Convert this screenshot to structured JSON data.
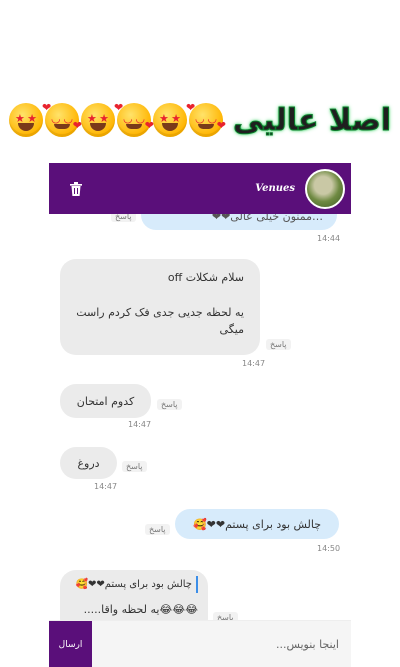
{
  "caption": {
    "text": "اصلا عالیی",
    "emoji_count": 6
  },
  "header": {
    "name": "Venues",
    "delete_icon": "trash-icon",
    "background": "#5a0f7a"
  },
  "messages": [
    {
      "dir": "out",
      "text": "…ممنون خیلی عالی❤❤",
      "reply": "پاسخ",
      "time": "14:44"
    },
    {
      "dir": "in",
      "text": "سلام شکلات off",
      "text2": "یه لحظه جدیی جدی فک کردم راست میگی",
      "reply": "پاسخ",
      "time": "14:47"
    },
    {
      "dir": "in",
      "text": "کدوم امتحان",
      "reply": "پاسخ",
      "time": "14:47"
    },
    {
      "dir": "in",
      "text": "دروغ",
      "reply": "پاسخ",
      "time": "14:47"
    },
    {
      "dir": "out",
      "text": "چالش بود برای پستم❤❤🥰",
      "reply": "پاسخ",
      "time": "14:50"
    },
    {
      "dir": "in",
      "quote": "چالش بود برای پستم❤❤🥰",
      "text": "😂😂😂یه لحظه واقا.....",
      "reply": "پاسخ"
    }
  ],
  "composer": {
    "placeholder": "اینجا بنویس...",
    "send_label": "ارسال"
  }
}
